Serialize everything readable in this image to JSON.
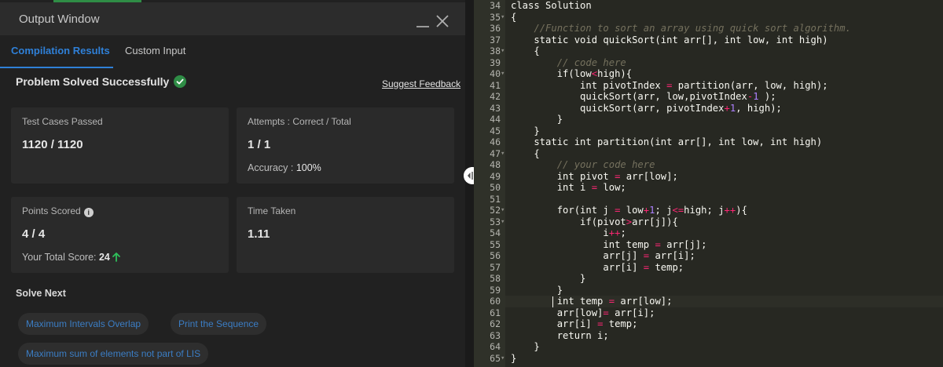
{
  "window": {
    "title": "Output Window",
    "minimize_label": "",
    "close_label": ""
  },
  "tabs": [
    {
      "label": "Compilation Results",
      "active": true
    },
    {
      "label": "Custom Input",
      "active": false
    }
  ],
  "result": {
    "status": "Problem Solved Successfully",
    "suggest_feedback": "Suggest Feedback"
  },
  "stats": {
    "test_cases": {
      "label": "Test Cases Passed",
      "value": "1120 / 1120"
    },
    "attempts": {
      "label": "Attempts : Correct / Total",
      "value": "1 / 1",
      "accuracy_label": "Accuracy : ",
      "accuracy_value": "100%"
    },
    "points": {
      "label": "Points Scored",
      "value": "4 / 4",
      "total_label": "Your Total Score: ",
      "total_value": "24"
    },
    "time": {
      "label": "Time Taken",
      "value": "1.11"
    }
  },
  "solve_next": {
    "title": "Solve Next",
    "items": [
      "Maximum Intervals Overlap",
      "Print the Sequence",
      "Maximum sum of elements not part of LIS"
    ]
  },
  "colors": {
    "accent_blue": "#2f80d8",
    "success_green": "#2f8d46",
    "editor_bg": "#272822"
  },
  "editor": {
    "lines": [
      {
        "n": "34",
        "fold": false,
        "html": "class Solution"
      },
      {
        "n": "35",
        "fold": true,
        "html": "{"
      },
      {
        "n": "36",
        "fold": false,
        "html": "    <span class=\"cm\">//Function to sort an array using quick sort algorithm.</span>"
      },
      {
        "n": "37",
        "fold": false,
        "html": "    static void quickSort(int arr[], int low, int high)"
      },
      {
        "n": "38",
        "fold": true,
        "html": "    {"
      },
      {
        "n": "39",
        "fold": false,
        "html": "        <span class=\"cm\">// code here</span>"
      },
      {
        "n": "40",
        "fold": true,
        "html": "        if(low<span class=\"op\">&lt;</span>high){"
      },
      {
        "n": "41",
        "fold": false,
        "html": "            int pivotIndex <span class=\"op\">=</span> partition(arr, low, high);"
      },
      {
        "n": "42",
        "fold": false,
        "html": "            quickSort(arr, low,pivotIndex<span class=\"op\">-</span><span class=\"nm\">1</span> );"
      },
      {
        "n": "43",
        "fold": false,
        "html": "            quickSort(arr, pivotIndex<span class=\"op\">+</span><span class=\"nm\">1</span>, high);"
      },
      {
        "n": "44",
        "fold": false,
        "html": "        }"
      },
      {
        "n": "45",
        "fold": false,
        "html": "    }"
      },
      {
        "n": "46",
        "fold": false,
        "html": "    static int partition(int arr[], int low, int high)"
      },
      {
        "n": "47",
        "fold": true,
        "html": "    {"
      },
      {
        "n": "48",
        "fold": false,
        "html": "        <span class=\"cm\">// your code here</span>"
      },
      {
        "n": "49",
        "fold": false,
        "html": "        int pivot <span class=\"op\">=</span> arr[low];"
      },
      {
        "n": "50",
        "fold": false,
        "html": "        int i <span class=\"op\">=</span> low;"
      },
      {
        "n": "51",
        "fold": false,
        "html": ""
      },
      {
        "n": "52",
        "fold": true,
        "html": "        for(int j <span class=\"op\">=</span> low<span class=\"op\">+</span><span class=\"nm\">1</span>; j<span class=\"op\">&lt;=</span>high; j<span class=\"op\">++</span>){"
      },
      {
        "n": "53",
        "fold": true,
        "html": "            if(pivot<span class=\"op\">&gt;</span>arr[j]){"
      },
      {
        "n": "54",
        "fold": false,
        "html": "                i<span class=\"op\">++</span>;"
      },
      {
        "n": "55",
        "fold": false,
        "html": "                int temp <span class=\"op\">=</span> arr[j];"
      },
      {
        "n": "56",
        "fold": false,
        "html": "                arr[j] <span class=\"op\">=</span> arr[i];"
      },
      {
        "n": "57",
        "fold": false,
        "html": "                arr[i] <span class=\"op\">=</span> temp;"
      },
      {
        "n": "58",
        "fold": false,
        "html": "            }"
      },
      {
        "n": "59",
        "fold": false,
        "html": "        }"
      },
      {
        "n": "60",
        "fold": false,
        "html": "        int temp <span class=\"op\">=</span> arr[low];"
      },
      {
        "n": "61",
        "fold": false,
        "html": "        arr[low]<span class=\"op\">=</span> arr[i];"
      },
      {
        "n": "62",
        "fold": false,
        "html": "        arr[i] <span class=\"op\">=</span> temp;"
      },
      {
        "n": "63",
        "fold": false,
        "html": "        return i;"
      },
      {
        "n": "64",
        "fold": false,
        "html": "    }"
      },
      {
        "n": "65",
        "fold": true,
        "html": "}"
      }
    ]
  }
}
